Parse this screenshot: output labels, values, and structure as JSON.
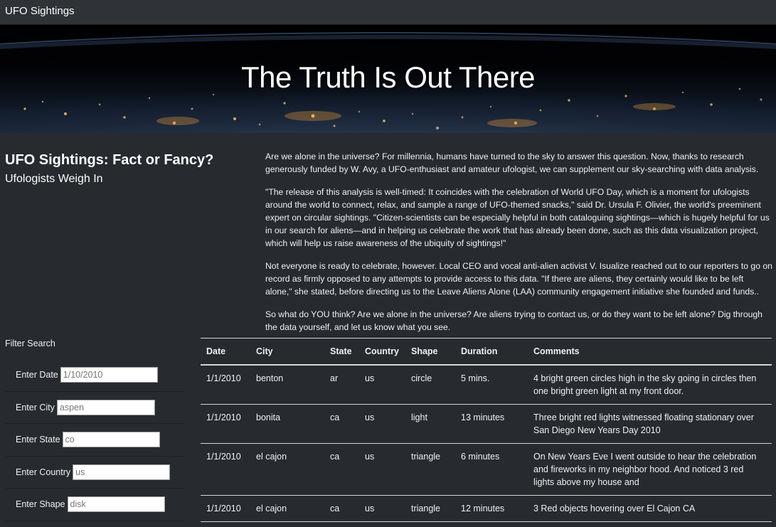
{
  "navbar": {
    "brand": "UFO Sightings"
  },
  "hero": {
    "heading": "The Truth Is Out There"
  },
  "intro": {
    "title": "UFO Sightings: Fact or Fancy?",
    "subtitle": "Ufologists Weigh In"
  },
  "article": {
    "paragraphs": [
      "Are we alone in the universe? For millennia, humans have turned to the sky to answer this question. Now, thanks to research generously funded by W. Avy, a UFO-enthusiast and amateur ufologist, we can supplement our sky-searching with data analysis.",
      "\"The release of this analysis is well-timed: It coincides with the celebration of World UFO Day, which is a moment for ufologists around the world to connect, relax, and sample a range of UFO-themed snacks,\" said Dr. Ursula F. Olivier, the world's preeminent expert on circular sightings. \"Citizen-scientists can be especially helpful in both cataloguing sightings—which is hugely helpful for us in our search for aliens—and in helping us celebrate the work that has already been done, such as this data visualization project, which will help us raise awareness of the ubiquity of sightings!\"",
      "Not everyone is ready to celebrate, however. Local CEO and vocal anti-alien activist V. Isualize reached out to our reporters to go on record as firmly opposed to any attempts to provide access to this data. \"If there are aliens, they certainly would like to be left alone,\" she stated, before directing us to the Leave Aliens Alone (LAA) community engagement initiative she founded and funds..",
      "So what do YOU think? Are we alone in the universe? Are aliens trying to contact us, or do they want to be left alone? Dig through the data yourself, and let us know what you see."
    ]
  },
  "filters": {
    "title": "Filter Search",
    "items": [
      {
        "label": "Enter Date",
        "value": "1/10/2010"
      },
      {
        "label": "Enter City",
        "value": "aspen"
      },
      {
        "label": "Enter State",
        "value": "co"
      },
      {
        "label": "Enter Country",
        "value": "us"
      },
      {
        "label": "Enter Shape",
        "value": "disk"
      }
    ]
  },
  "table": {
    "headers": [
      "Date",
      "City",
      "State",
      "Country",
      "Shape",
      "Duration",
      "Comments"
    ],
    "rows": [
      [
        "1/1/2010",
        "benton",
        "ar",
        "us",
        "circle",
        "5 mins.",
        "4 bright green circles high in the sky going in circles then one bright green light at my front door."
      ],
      [
        "1/1/2010",
        "bonita",
        "ca",
        "us",
        "light",
        "13 minutes",
        "Three bright red lights witnessed floating stationary over San Diego New Years Day 2010"
      ],
      [
        "1/1/2010",
        "el cajon",
        "ca",
        "us",
        "triangle",
        "6 minutes",
        "On New Years Eve I went outside to hear the celebration and fireworks in my neighbor hood. And noticed 3 red lights above my house and"
      ],
      [
        "1/1/2010",
        "el cajon",
        "ca",
        "us",
        "triangle",
        "12 minutes",
        "3 Red objects hovering over El Cajon CA"
      ]
    ]
  }
}
